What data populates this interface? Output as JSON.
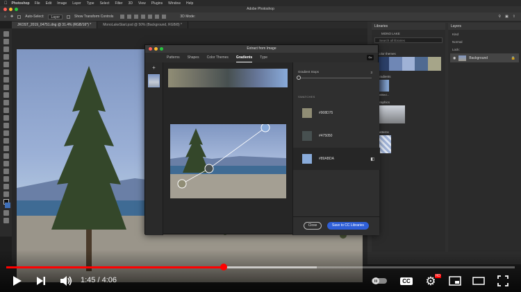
{
  "menubar": {
    "app": "Photoshop",
    "items": [
      "File",
      "Edit",
      "Image",
      "Layer",
      "Type",
      "Select",
      "Filter",
      "3D",
      "View",
      "Plugins",
      "Window",
      "Help"
    ]
  },
  "window_title": "Adobe Photoshop",
  "options": {
    "auto_select": "Auto-Select:",
    "layer_value": "Layer",
    "show_transform": "Show Transform Controls",
    "mode_3d": "3D Mode:"
  },
  "doc_tabs": [
    "JKOST_2019_04751.dng @ 31.4% (RGB/16*) *",
    "MonoLakeStart.psd @ 50% (Background, RGB/8) *"
  ],
  "libraries": {
    "title": "Libraries",
    "library_name": "MONO LAKE",
    "search_placeholder": "Search all libraries",
    "sections": [
      "Color themes",
      "Gradients",
      "Graphics",
      "Patterns"
    ],
    "gradient_label": "Untitled...",
    "theme_colors": [
      "#2b3f68",
      "#6f87b5",
      "#9fb2d6",
      "#4f6a91",
      "#a6a589"
    ]
  },
  "layers": {
    "title": "Layers",
    "kind_label": "Kind",
    "blend_label": "Normal",
    "lock_label": "Lock:",
    "layer_name": "Background"
  },
  "dialog": {
    "title": "Extract from Image",
    "tabs": [
      "Patterns",
      "Shapes",
      "Color Themes",
      "Gradients",
      "Type"
    ],
    "active_tab": "Gradients",
    "cc_label": "Cc",
    "gradient_stops_label": "Gradient Stops",
    "gradient_stops_value": "3",
    "swatches_label": "SWATCHES",
    "swatches": [
      {
        "hex": "#908D75",
        "color": "#908D75"
      },
      {
        "hex": "#475050",
        "color": "#475050"
      },
      {
        "hex": "#89ABDA",
        "color": "#89ABDA"
      }
    ],
    "close_label": "Close",
    "save_label": "Save to CC Libraries"
  },
  "video": {
    "current_time": "1:45",
    "duration": "4:06",
    "time_separator": "/",
    "played_fraction": 0.427,
    "buffered_fraction": 0.61,
    "cc_label": "CC",
    "hd_label": "HD"
  }
}
